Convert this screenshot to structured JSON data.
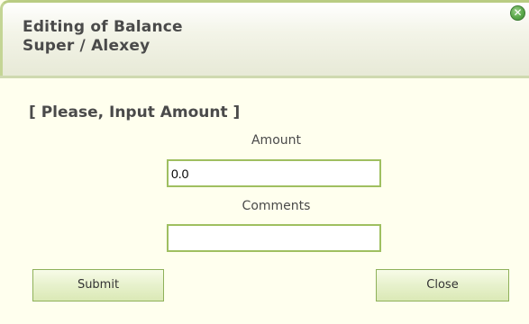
{
  "dialog": {
    "title_line1": "Editing of Balance",
    "title_line2": "Super / Alexey",
    "close_icon": "close-icon",
    "instruction": "[ Please, Input Amount ]"
  },
  "form": {
    "amount_label": "Amount",
    "amount_value": "0.0",
    "comments_label": "Comments",
    "comments_value": ""
  },
  "buttons": {
    "submit_label": "Submit",
    "close_label": "Close"
  },
  "colors": {
    "background": "#ffffee",
    "accent_border": "#9fbf60",
    "text": "#4a4a4a"
  }
}
